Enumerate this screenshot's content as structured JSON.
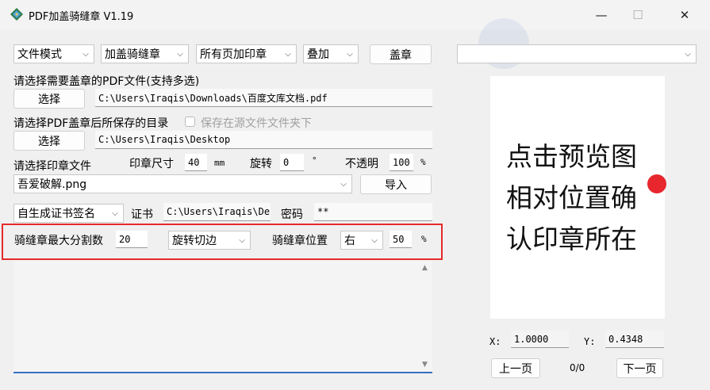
{
  "window": {
    "title": "PDF加盖骑缝章 V1.19",
    "minimize_glyph": "—",
    "maximize_glyph": "☐",
    "close_glyph": "✕"
  },
  "toolbar": {
    "mode": "文件模式",
    "action": "加盖骑缝章",
    "pages": "所有页加印章",
    "overlay": "叠加",
    "stamp_button": "盖章"
  },
  "source": {
    "label": "请选择需要盖章的PDF文件(支持多选)",
    "select_button": "选择",
    "path": "C:\\Users\\Iraqis\\Downloads\\百度文库文档.pdf"
  },
  "output": {
    "label": "请选择PDF盖章后所保存的目录",
    "checkbox_label": "保存在源文件文件夹下",
    "select_button": "选择",
    "path": "C:\\Users\\Iraqis\\Desktop"
  },
  "seal": {
    "label": "请选择印章文件",
    "size_label": "印章尺寸",
    "size_value": "40",
    "size_unit": "mm",
    "rotate_label": "旋转",
    "rotate_value": "0",
    "rotate_unit": "°",
    "opacity_label": "不透明",
    "opacity_value": "100",
    "opacity_unit": "%",
    "file": "吾爱破解.png",
    "import_button": "导入"
  },
  "cert": {
    "mode": "自生成证书签名",
    "label": "证书",
    "path": "C:\\Users\\Iraqis\\De",
    "password_label": "密码",
    "password_value": "**"
  },
  "riding": {
    "max_split_label": "骑缝章最大分割数",
    "max_split_value": "20",
    "cut_mode": "旋转切边",
    "position_label": "骑缝章位置",
    "position_value": "右",
    "percent_value": "50",
    "percent_unit": "%"
  },
  "preview": {
    "page_select": "",
    "text": "点击预览图\n相对位置确\n认印章所在",
    "x_label": "X:",
    "x_value": "1.0000",
    "y_label": "Y:",
    "y_value": "0.4348",
    "prev_button": "上一页",
    "page_counter": "0/0",
    "next_button": "下一页"
  },
  "colors": {
    "highlight_border": "#e52a2a",
    "marker": "#e8262d",
    "log_underline": "#3a6fc0"
  }
}
